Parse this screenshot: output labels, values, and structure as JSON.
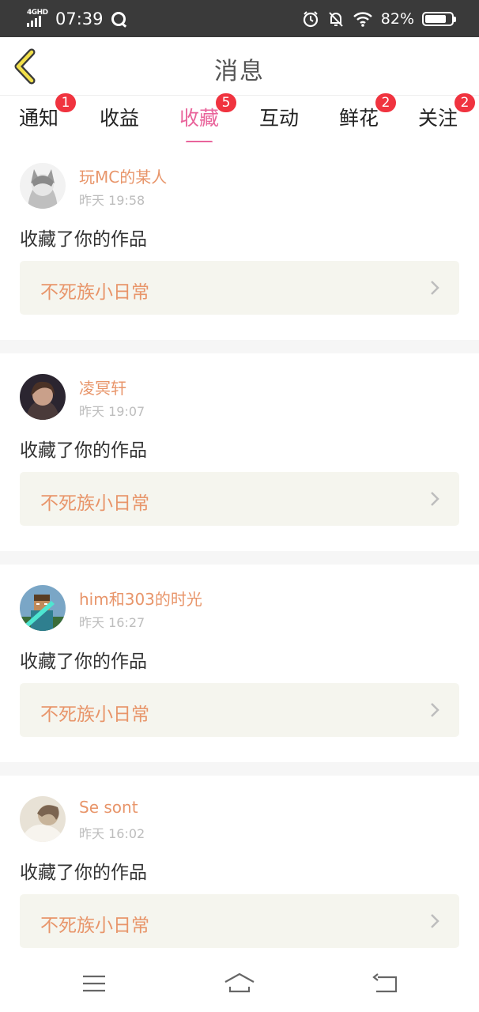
{
  "status_bar": {
    "network": "4GHD",
    "time": "07:39",
    "battery": "82%",
    "battery_level": 0.82,
    "icons": [
      "signal-icon",
      "qq-icon",
      "alarm-icon",
      "mute-icon",
      "wifi-icon",
      "battery-icon"
    ]
  },
  "header": {
    "title": "消息",
    "back_icon": "chevron-left-icon"
  },
  "tabs": [
    {
      "label": "通知",
      "badge": "1",
      "active": false
    },
    {
      "label": "收益",
      "badge": "",
      "active": false
    },
    {
      "label": "收藏",
      "badge": "5",
      "active": true
    },
    {
      "label": "互动",
      "badge": "",
      "active": false
    },
    {
      "label": "鲜花",
      "badge": "2",
      "active": false
    },
    {
      "label": "关注",
      "badge": "2",
      "active": false
    }
  ],
  "messages": [
    {
      "user": "玩MC的某人",
      "time": "昨天 19:58",
      "action": "收藏了你的作品",
      "work": "不死族小日常"
    },
    {
      "user": "凌冥轩",
      "time": "昨天 19:07",
      "action": "收藏了你的作品",
      "work": "不死族小日常"
    },
    {
      "user": "him和303的时光",
      "time": "昨天 16:27",
      "action": "收藏了你的作品",
      "work": "不死族小日常"
    },
    {
      "user": "Se sont",
      "time": "昨天 16:02",
      "action": "收藏了你的作品",
      "work": "不死族小日常"
    }
  ],
  "colors": {
    "accent_pink": "#e9649b",
    "username_orange": "#e8956a",
    "badge_red": "#f0333f",
    "back_arrow_yellow": "#f2e04a"
  },
  "nav": {
    "icons": [
      "menu-icon",
      "home-icon",
      "back-icon"
    ]
  }
}
